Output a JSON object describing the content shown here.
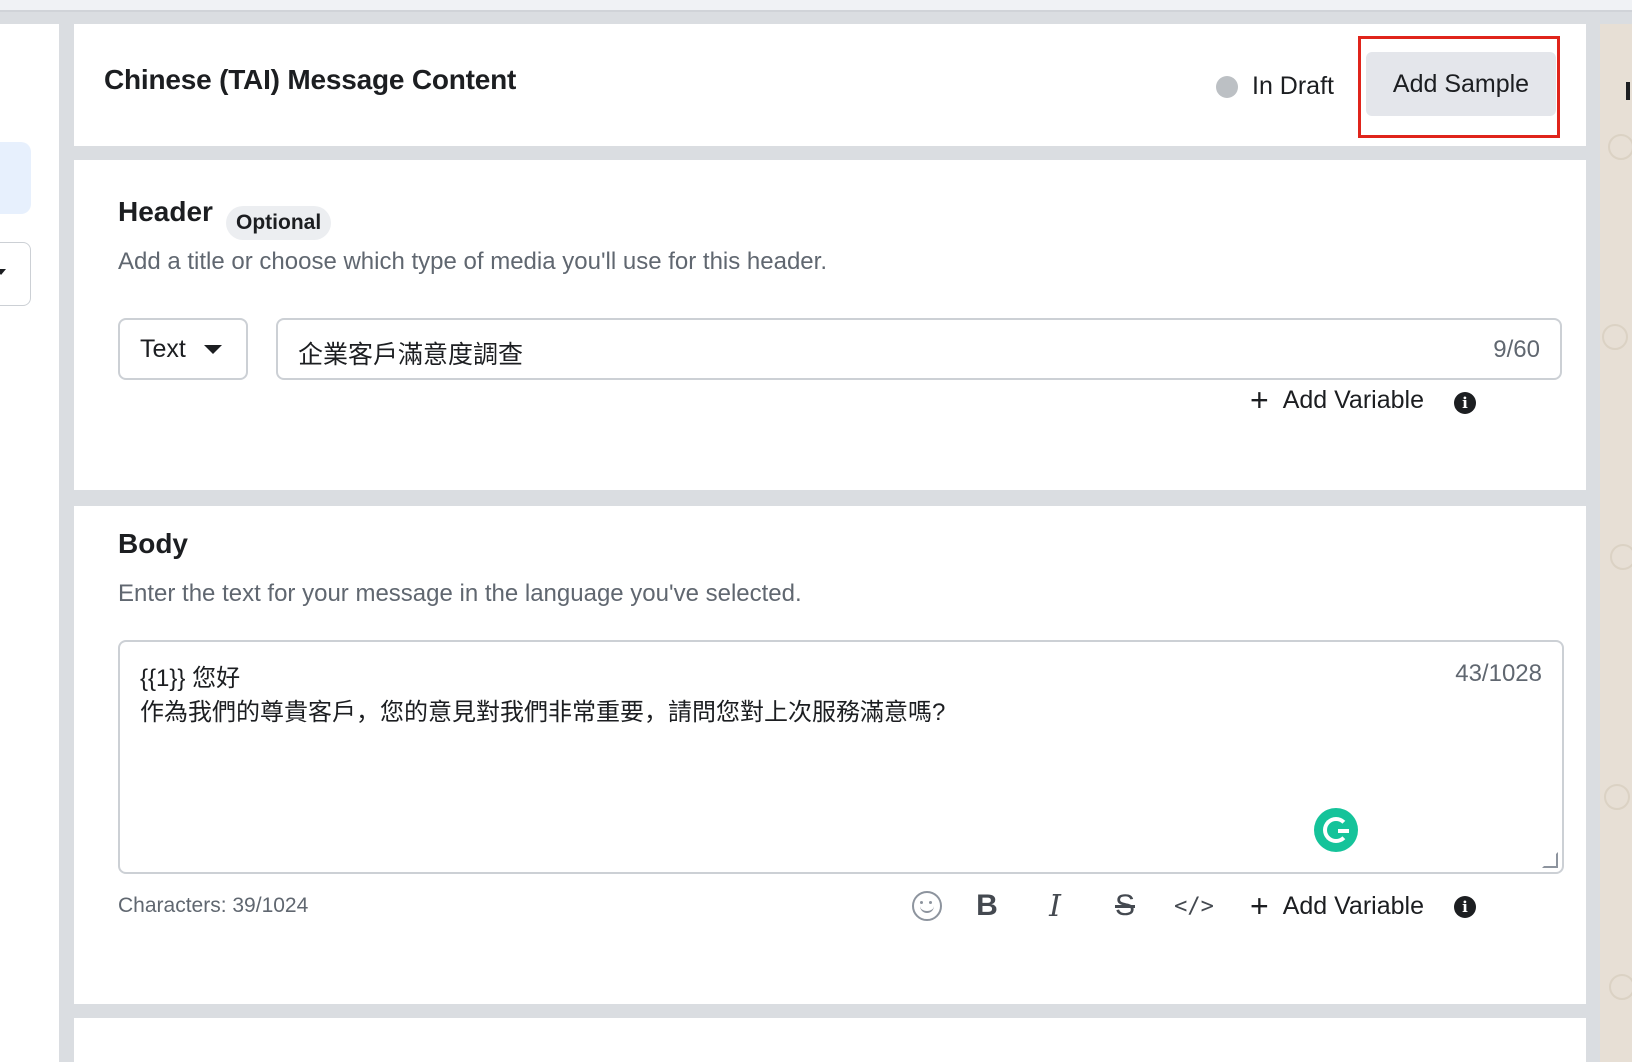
{
  "top_card": {
    "title": "Chinese (TAI) Message Content",
    "status": "In Draft",
    "add_sample_label": "Add Sample"
  },
  "header_section": {
    "title": "Header",
    "badge": "Optional",
    "description": "Add a title or choose which type of media you'll use for this header.",
    "type_value": "Text",
    "input_value": "企業客戶滿意度調查",
    "counter": "9/60",
    "add_variable_label": "Add Variable"
  },
  "body_section": {
    "title": "Body",
    "description": "Enter the text for your message in the language you've selected.",
    "lines": [
      "{{1}} 您好",
      "作為我們的尊貴客戶，您的意見對我們非常重要，請問您對上次服務滿意嗎?"
    ],
    "counter": "43/1028",
    "characters": "Characters: 39/1024",
    "toolbar": {
      "bold": "B",
      "italic": "I",
      "strike": "S",
      "code": "</>"
    },
    "add_variable_label": "Add Variable"
  },
  "icons": [
    "status-dot-icon",
    "caret-down-icon",
    "plus-icon",
    "info-icon",
    "emoji-icon",
    "grammarly-icon",
    "resize-handle-icon"
  ],
  "colors": {
    "highlight_frame": "#e0241b",
    "status_dot": "#bcc0c4",
    "grammarly": "#15c39a",
    "page_background": "#dadde1"
  }
}
